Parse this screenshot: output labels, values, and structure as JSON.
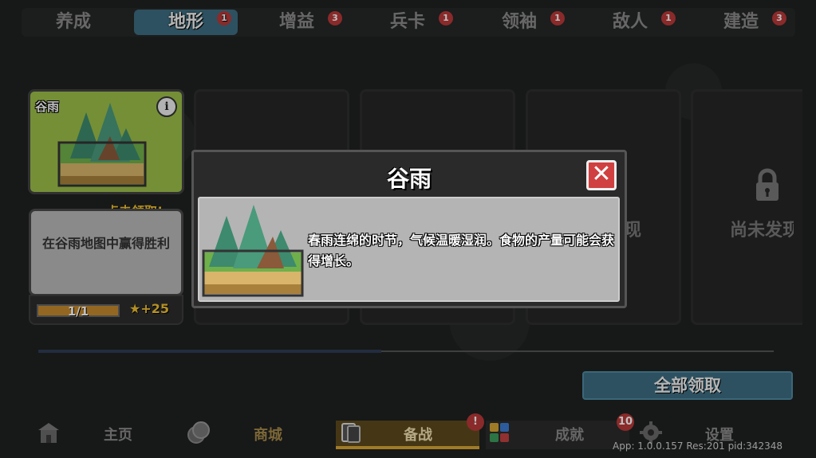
{
  "tabs": [
    {
      "label": "养成",
      "badge": ""
    },
    {
      "label": "地形",
      "badge": "1",
      "active": true
    },
    {
      "label": "增益",
      "badge": "3"
    },
    {
      "label": "兵卡",
      "badge": "1"
    },
    {
      "label": "领袖",
      "badge": "1"
    },
    {
      "label": "敌人",
      "badge": "1"
    },
    {
      "label": "建造",
      "badge": "3"
    }
  ],
  "card": {
    "name": "谷雨",
    "claim_hint": "点击领取!",
    "quest": "在谷雨地图中赢得胜利",
    "progress_text": "1/1",
    "progress": 1.0,
    "reward": "+25"
  },
  "locked": {
    "partial_label_1": "现",
    "partial_label_2": "尚未发现"
  },
  "claim_all": "全部领取",
  "nav": {
    "home": "主页",
    "shop": "商城",
    "prepare": "备战",
    "prepare_badge": "!",
    "achievements": "成就",
    "achievements_badge": "10",
    "settings": "设置"
  },
  "version": "App: 1.0.0.157 Res:201 pid:342348",
  "modal": {
    "title": "谷雨",
    "description": "春雨连绵的时节，气候温暖湿润。食物的产量可能会获得增长。"
  },
  "colors": {
    "accent": "#3d6d80",
    "gold": "#f0c030",
    "badge": "#b83838"
  }
}
